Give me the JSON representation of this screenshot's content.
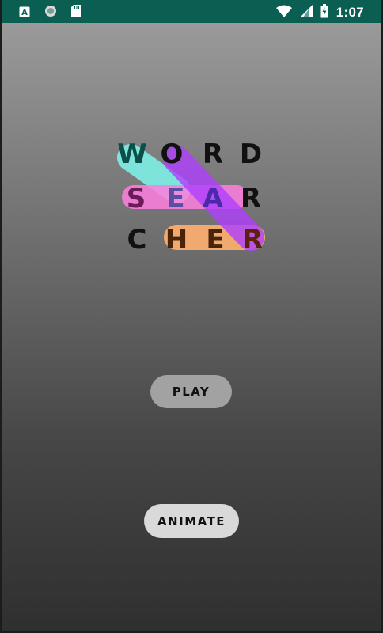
{
  "status_bar": {
    "time": "1:07",
    "left_icons": [
      "text-a-icon",
      "circle-icon",
      "sd-card-icon"
    ],
    "right_icons": [
      "wifi-icon",
      "signal-icon",
      "battery-charging-icon"
    ],
    "background": "#0b5f52"
  },
  "logo": {
    "rows": [
      [
        "W",
        "O",
        "R",
        "D"
      ],
      [
        "S",
        "E",
        "A",
        "R"
      ],
      [
        "C",
        "H",
        "E",
        "R"
      ]
    ],
    "highlight_colors": [
      "#7ff0e6",
      "#ff7fe0",
      "#b040ff",
      "#ffb070"
    ]
  },
  "buttons": {
    "play": "PLAY",
    "animate": "ANIMATE"
  }
}
